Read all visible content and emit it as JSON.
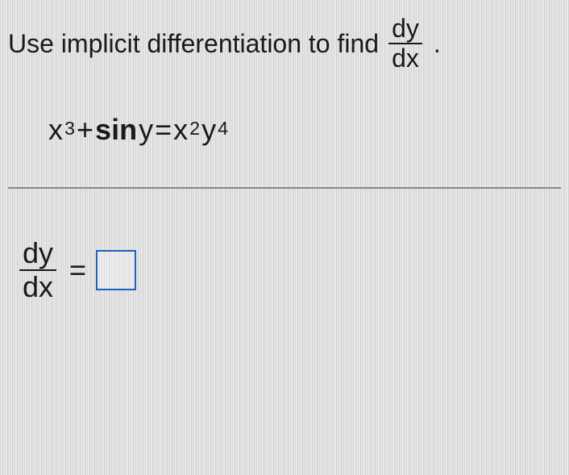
{
  "problem": {
    "instruction_prefix": "Use implicit differentiation to find",
    "fraction_num": "dy",
    "fraction_den": "dx",
    "period": "."
  },
  "equation": {
    "term1_base": "x",
    "term1_exp": "3",
    "plus": " + ",
    "sin": "sin",
    "sin_arg": " y",
    "equals": " = ",
    "rhs_x_base": "x",
    "rhs_x_exp": "2",
    "rhs_y_base": "y",
    "rhs_y_exp": "4"
  },
  "answer": {
    "fraction_num": "dy",
    "fraction_den": "dx",
    "equals": "=",
    "input_value": ""
  }
}
